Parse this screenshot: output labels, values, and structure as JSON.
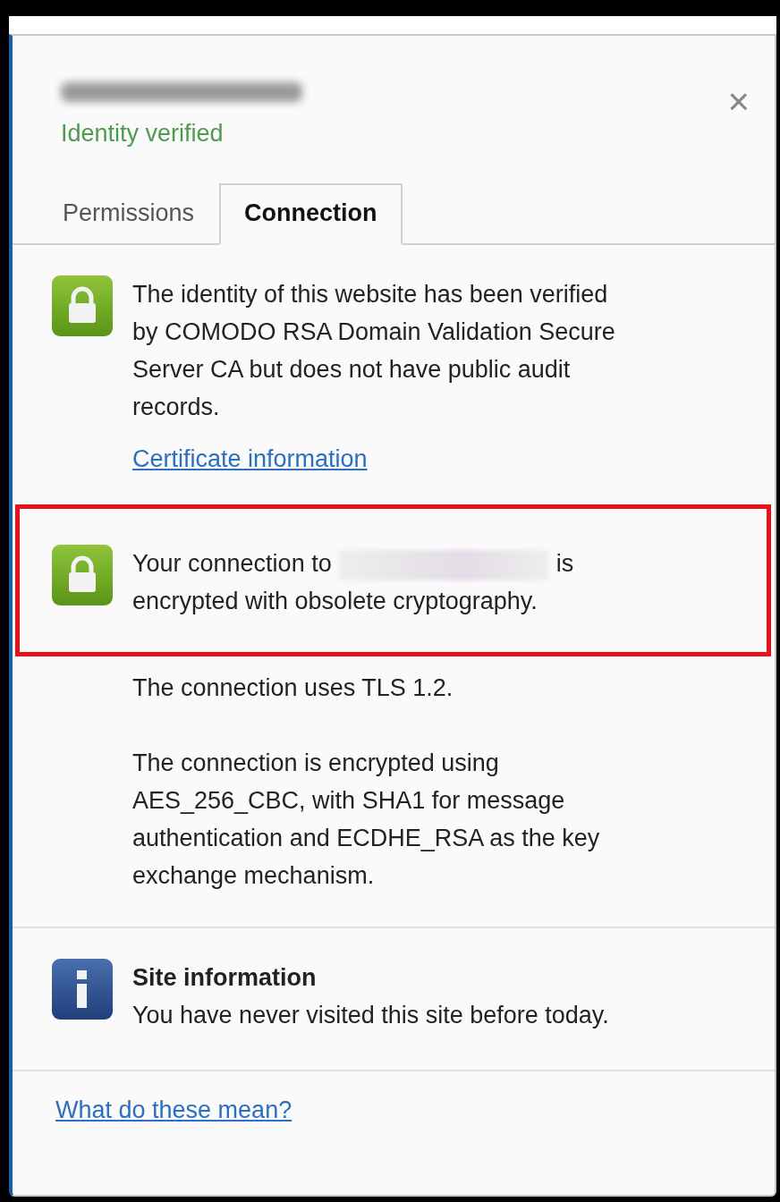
{
  "header": {
    "status": "Identity verified",
    "close": "×"
  },
  "tabs": [
    {
      "label": "Permissions",
      "selected": false
    },
    {
      "label": "Connection",
      "selected": true
    }
  ],
  "identity": {
    "text": "The identity of this website has been verified by COMODO RSA Domain Validation Secure Server CA but does not have public audit records.",
    "link": "Certificate information"
  },
  "encryption": {
    "highlighted": true,
    "before": "Your connection to",
    "after": "is encrypted with obsolete cryptography."
  },
  "details": [
    "The connection uses TLS 1.2.",
    "The connection is encrypted using AES_256_CBC, with SHA1 for message authentication and ECDHE_RSA as the key exchange mechanism."
  ],
  "site_info": {
    "title": "Site information",
    "text": "You have never visited this site before today."
  },
  "footer_link": "What do these mean?"
}
